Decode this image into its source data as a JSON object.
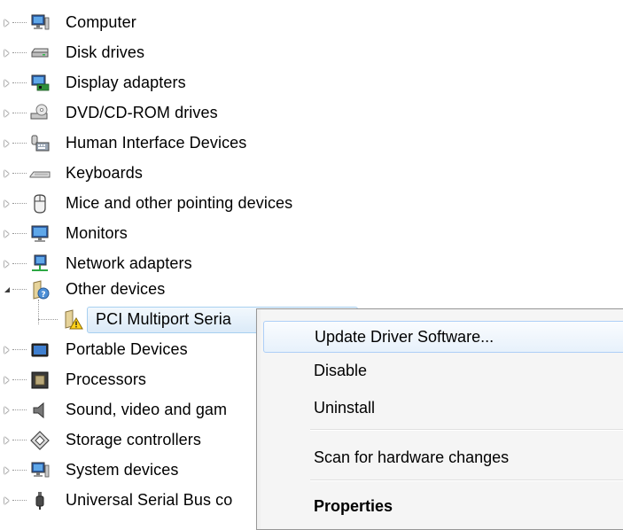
{
  "tree": {
    "items": [
      {
        "label": "Computer",
        "icon": "computer-icon"
      },
      {
        "label": "Disk drives",
        "icon": "disk-drive-icon"
      },
      {
        "label": "Display adapters",
        "icon": "display-adapter-icon"
      },
      {
        "label": "DVD/CD-ROM drives",
        "icon": "dvd-drive-icon"
      },
      {
        "label": "Human Interface Devices",
        "icon": "hid-icon"
      },
      {
        "label": "Keyboards",
        "icon": "keyboard-icon"
      },
      {
        "label": "Mice and other pointing devices",
        "icon": "mouse-icon"
      },
      {
        "label": "Monitors",
        "icon": "monitor-icon"
      },
      {
        "label": "Network adapters",
        "icon": "network-adapter-icon"
      },
      {
        "label": "Other devices",
        "icon": "unknown-device-icon",
        "expanded": true
      },
      {
        "label": "PCI Multiport Seria",
        "icon": "warning-device-icon",
        "child": true,
        "selected": true
      },
      {
        "label": "Portable Devices",
        "icon": "portable-device-icon"
      },
      {
        "label": "Processors",
        "icon": "processor-icon"
      },
      {
        "label": "Sound, video and gam",
        "icon": "sound-icon"
      },
      {
        "label": "Storage controllers",
        "icon": "storage-controller-icon"
      },
      {
        "label": "System devices",
        "icon": "system-device-icon"
      },
      {
        "label": "Universal Serial Bus co",
        "icon": "usb-icon"
      }
    ]
  },
  "context_menu": {
    "items": [
      {
        "label": "Update Driver Software...",
        "hover": true
      },
      {
        "label": "Disable"
      },
      {
        "label": "Uninstall"
      },
      {
        "label": "Scan for hardware changes"
      },
      {
        "label": "Properties",
        "bold": true
      }
    ]
  }
}
